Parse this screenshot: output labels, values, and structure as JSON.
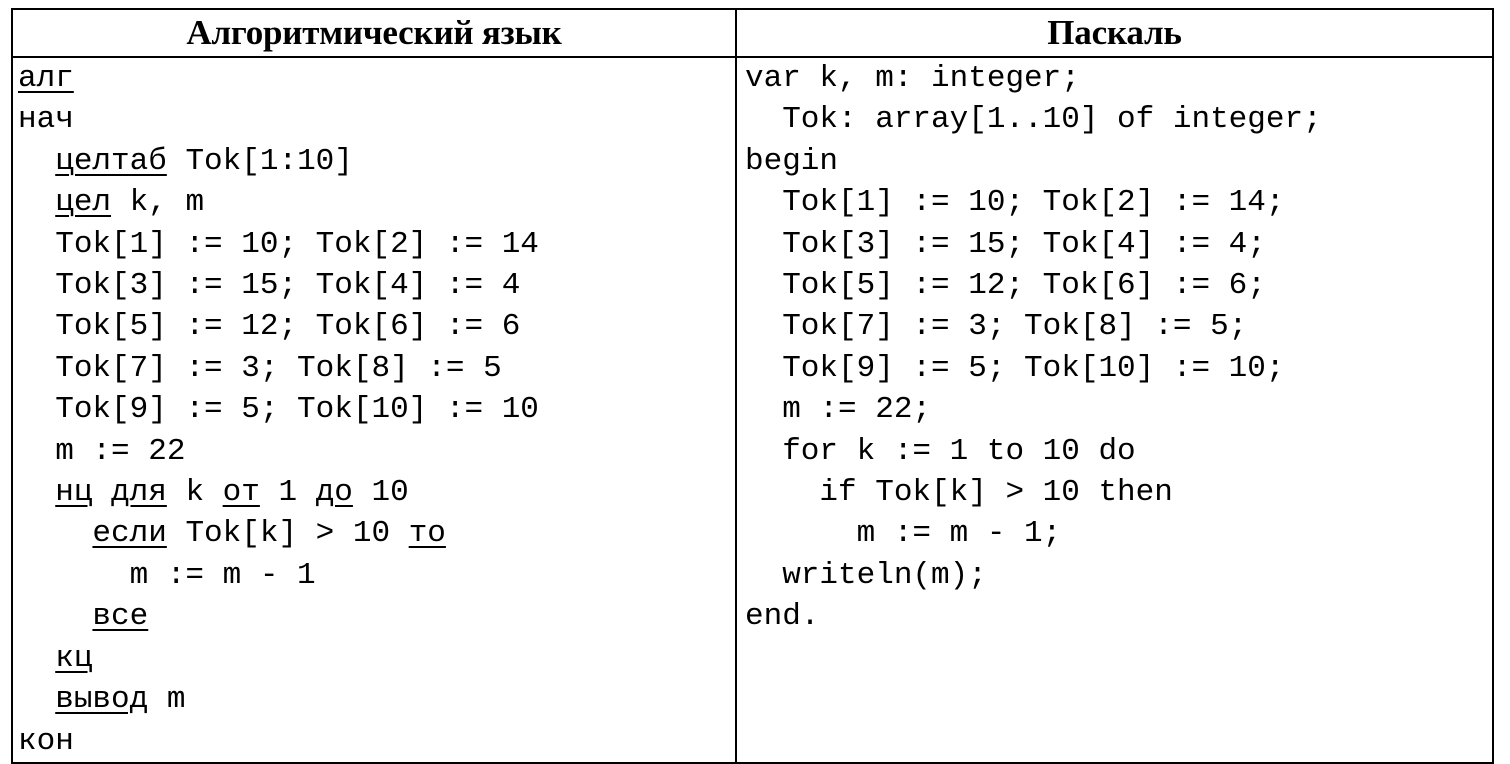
{
  "table": {
    "columns": [
      {
        "id": "alg",
        "header": "Алгоритмический язык"
      },
      {
        "id": "pascal",
        "header": "Паскаль"
      }
    ]
  },
  "algorithmic_language": {
    "header": "Алгоритмический язык",
    "lines": [
      {
        "indent": 0,
        "tokens": [
          {
            "t": "алг",
            "kw": true
          }
        ]
      },
      {
        "indent": 0,
        "tokens": [
          {
            "t": "нач",
            "kw": false
          }
        ]
      },
      {
        "indent": 2,
        "tokens": [
          {
            "t": "целтаб",
            "kw": true
          },
          {
            "t": " Tok[1:10]",
            "kw": false
          }
        ]
      },
      {
        "indent": 2,
        "tokens": [
          {
            "t": "цел",
            "kw": true
          },
          {
            "t": " k, m",
            "kw": false
          }
        ]
      },
      {
        "indent": 2,
        "tokens": [
          {
            "t": "Tok[1] := 10; Tok[2] := 14",
            "kw": false
          }
        ]
      },
      {
        "indent": 2,
        "tokens": [
          {
            "t": "Tok[3] := 15; Tok[4] := 4",
            "kw": false
          }
        ]
      },
      {
        "indent": 2,
        "tokens": [
          {
            "t": "Tok[5] := 12; Tok[6] := 6",
            "kw": false
          }
        ]
      },
      {
        "indent": 2,
        "tokens": [
          {
            "t": "Tok[7] := 3; Tok[8] := 5",
            "kw": false
          }
        ]
      },
      {
        "indent": 2,
        "tokens": [
          {
            "t": "Tok[9] := 5; Tok[10] := 10",
            "kw": false
          }
        ]
      },
      {
        "indent": 2,
        "tokens": [
          {
            "t": "m := 22",
            "kw": false
          }
        ]
      },
      {
        "indent": 2,
        "tokens": [
          {
            "t": "нц",
            "kw": true
          },
          {
            "t": " ",
            "kw": false
          },
          {
            "t": "для",
            "kw": true
          },
          {
            "t": " k ",
            "kw": false
          },
          {
            "t": "от",
            "kw": true
          },
          {
            "t": " 1 ",
            "kw": false
          },
          {
            "t": "до",
            "kw": true
          },
          {
            "t": " 10",
            "kw": false
          }
        ]
      },
      {
        "indent": 4,
        "tokens": [
          {
            "t": "если",
            "kw": true
          },
          {
            "t": " Tok[k] > 10 ",
            "kw": false
          },
          {
            "t": "то",
            "kw": true
          }
        ]
      },
      {
        "indent": 6,
        "tokens": [
          {
            "t": "m := m - 1",
            "kw": false
          }
        ]
      },
      {
        "indent": 4,
        "tokens": [
          {
            "t": "все",
            "kw": true
          }
        ]
      },
      {
        "indent": 2,
        "tokens": [
          {
            "t": "кц",
            "kw": true
          }
        ]
      },
      {
        "indent": 2,
        "tokens": [
          {
            "t": "вывод",
            "kw": true
          },
          {
            "t": " m",
            "kw": false
          }
        ]
      },
      {
        "indent": 0,
        "tokens": [
          {
            "t": "кон",
            "kw": false
          }
        ]
      }
    ]
  },
  "pascal": {
    "header": "Паскаль",
    "lines": [
      {
        "indent": 0,
        "text": "var k, m: integer;"
      },
      {
        "indent": 2,
        "text": "Tok: array[1..10] of integer;"
      },
      {
        "indent": 0,
        "text": "begin"
      },
      {
        "indent": 2,
        "text": "Tok[1] := 10; Tok[2] := 14;"
      },
      {
        "indent": 2,
        "text": "Tok[3] := 15; Tok[4] := 4;"
      },
      {
        "indent": 2,
        "text": "Tok[5] := 12; Tok[6] := 6;"
      },
      {
        "indent": 2,
        "text": "Tok[7] := 3; Tok[8] := 5;"
      },
      {
        "indent": 2,
        "text": "Tok[9] := 5; Tok[10] := 10;"
      },
      {
        "indent": 2,
        "text": "m := 22;"
      },
      {
        "indent": 2,
        "text": "for k := 1 to 10 do"
      },
      {
        "indent": 4,
        "text": "if Tok[k] > 10 then"
      },
      {
        "indent": 6,
        "text": "m := m - 1;"
      },
      {
        "indent": 2,
        "text": "writeln(m);"
      },
      {
        "indent": 0,
        "text": "end."
      }
    ]
  },
  "program_values": {
    "array_name": "Tok",
    "array_bounds": "1..10",
    "array_values": [
      10,
      14,
      15,
      4,
      12,
      6,
      3,
      5,
      5,
      10
    ],
    "m_initial": 22,
    "loop_from": 1,
    "loop_to": 10,
    "condition_threshold": 10,
    "decrement": 1
  },
  "colors": {
    "text": "#000000",
    "background": "#ffffff",
    "border": "#000000"
  }
}
